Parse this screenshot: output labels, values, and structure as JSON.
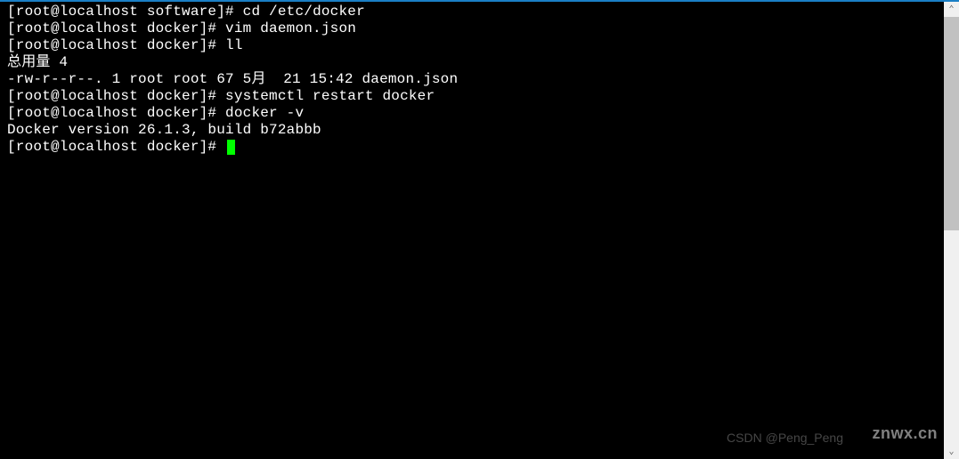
{
  "terminal": {
    "lines": [
      {
        "prompt": "[root@localhost software]# ",
        "cmd": "cd /etc/docker"
      },
      {
        "prompt": "[root@localhost docker]# ",
        "cmd": "vim daemon.json"
      },
      {
        "prompt": "[root@localhost docker]# ",
        "cmd": "ll"
      },
      {
        "text": "总用量 4"
      },
      {
        "text": "-rw-r--r--. 1 root root 67 5月  21 15:42 daemon.json"
      },
      {
        "prompt": "[root@localhost docker]# ",
        "cmd": "systemctl restart docker"
      },
      {
        "prompt": "[root@localhost docker]# ",
        "cmd": "docker -v"
      },
      {
        "text": "Docker version 26.1.3, build b72abbb"
      },
      {
        "prompt": "[root@localhost docker]# ",
        "cursor": true
      }
    ]
  },
  "watermarks": {
    "right": "znwx.cn",
    "left": "CSDN @Peng_Peng"
  },
  "scroll": {
    "up": "⌃",
    "down": "⌄"
  }
}
